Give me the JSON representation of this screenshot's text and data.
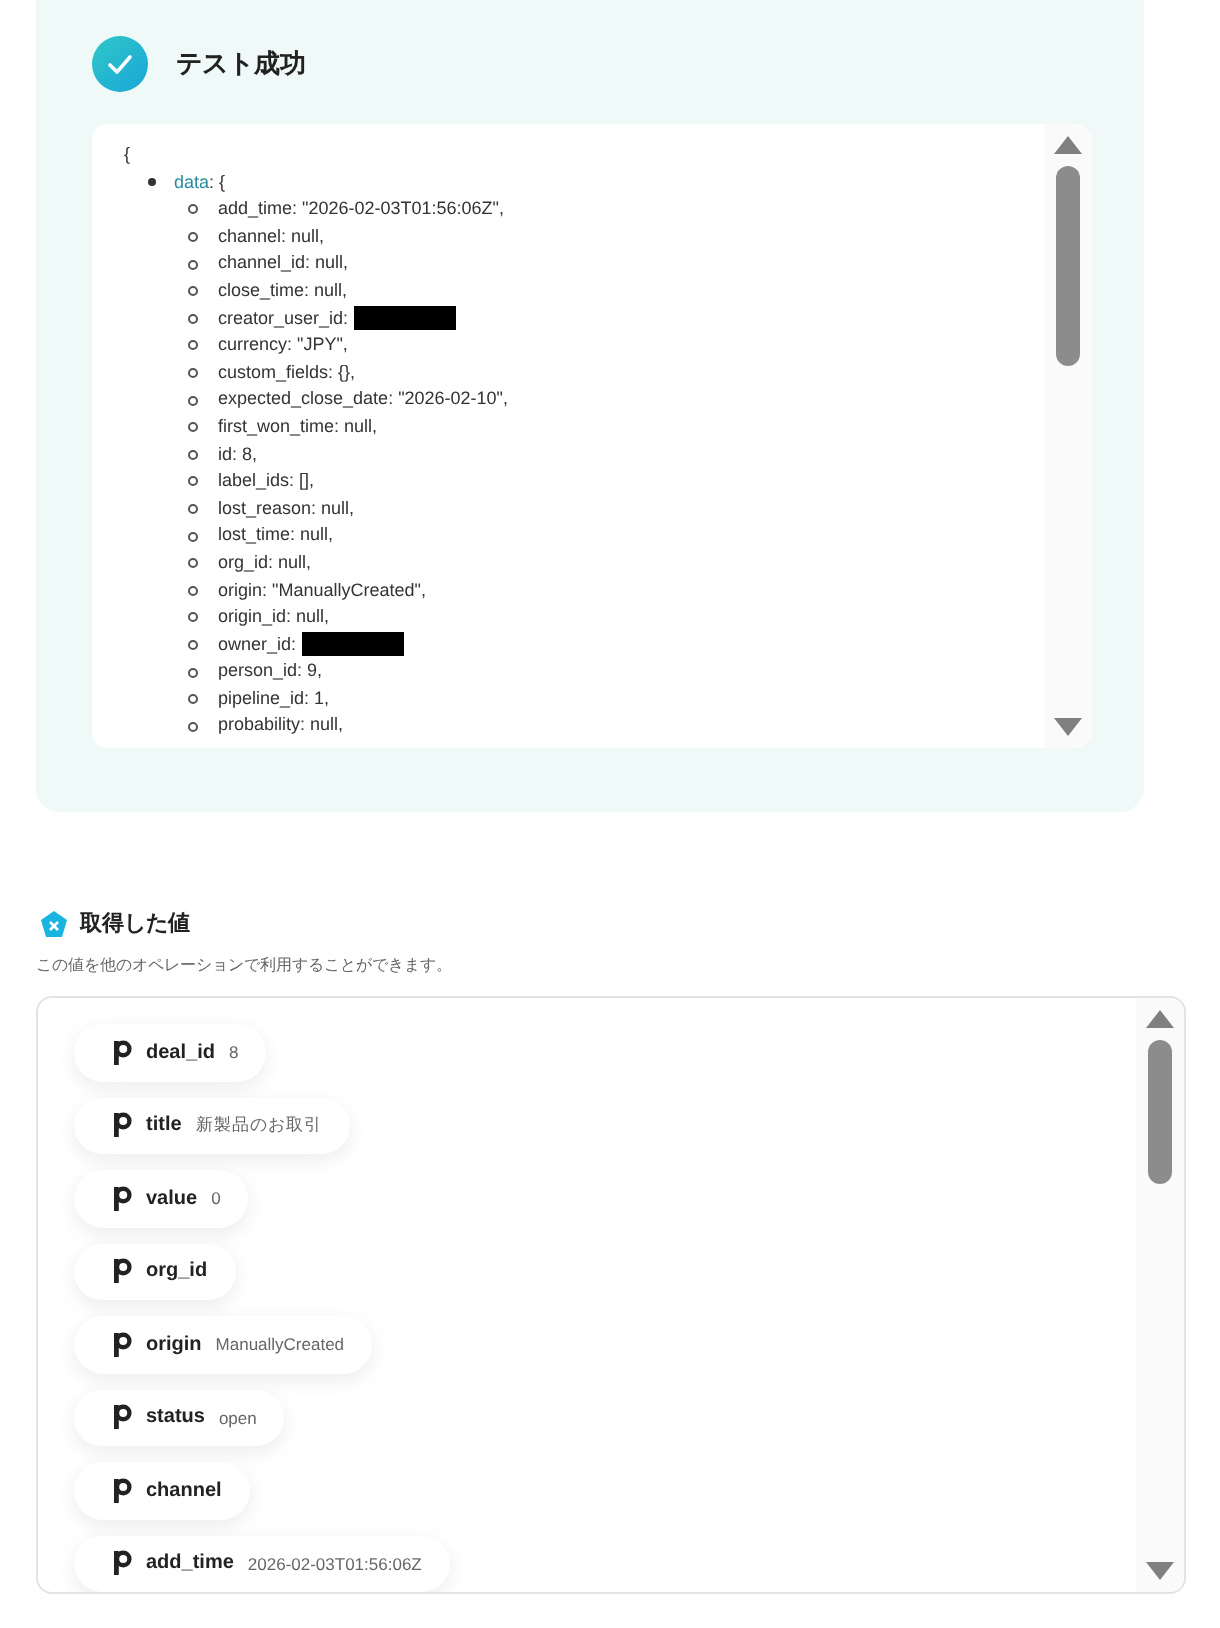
{
  "test_result": {
    "title": "テスト成功",
    "open_brace": "{",
    "root_key": "data",
    "root_suffix": ": {",
    "fields": [
      {
        "text": "add_time: \"2026-02-03T01:56:06Z\","
      },
      {
        "text": "channel: null,"
      },
      {
        "text": "channel_id: null,"
      },
      {
        "text": "close_time: null,"
      },
      {
        "text": "creator_user_id:",
        "redacted": true
      },
      {
        "text": "currency: \"JPY\","
      },
      {
        "text": "custom_fields: {},"
      },
      {
        "text": "expected_close_date: \"2026-02-10\","
      },
      {
        "text": "first_won_time: null,"
      },
      {
        "text": "id: 8,"
      },
      {
        "text": "label_ids: [],"
      },
      {
        "text": "lost_reason: null,"
      },
      {
        "text": "lost_time: null,"
      },
      {
        "text": "org_id: null,"
      },
      {
        "text": "origin: \"ManuallyCreated\","
      },
      {
        "text": "origin_id: null,"
      },
      {
        "text": "owner_id:",
        "redacted": true
      },
      {
        "text": "person_id: 9,"
      },
      {
        "text": "pipeline_id: 1,"
      },
      {
        "text": "probability: null,"
      }
    ]
  },
  "output_values": {
    "title": "取得した値",
    "description": "この値を他のオペレーションで利用することができます。",
    "items": [
      {
        "key": "deal_id",
        "value": "8"
      },
      {
        "key": "title",
        "value": "新製品のお取引"
      },
      {
        "key": "value",
        "value": "0"
      },
      {
        "key": "org_id"
      },
      {
        "key": "origin",
        "value": "ManuallyCreated"
      },
      {
        "key": "status",
        "value": "open"
      },
      {
        "key": "channel"
      },
      {
        "key": "add_time",
        "value": "2026-02-03T01:56:06Z"
      }
    ]
  }
}
